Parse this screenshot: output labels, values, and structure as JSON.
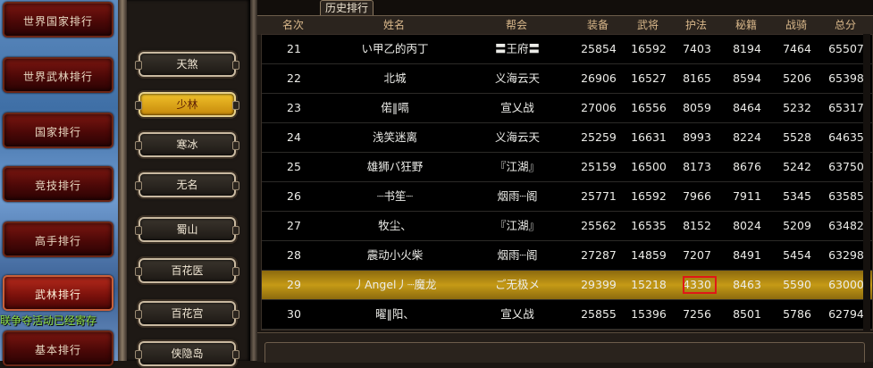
{
  "menu": {
    "items": [
      {
        "label": "世界国家排行",
        "active": false
      },
      {
        "label": "世界武林排行",
        "active": false
      },
      {
        "label": "国家排行",
        "active": false
      },
      {
        "label": "竞技排行",
        "active": false
      },
      {
        "label": "高手排行",
        "active": false
      },
      {
        "label": "武林排行",
        "active": true
      },
      {
        "label": "基本排行",
        "active": false
      }
    ],
    "notice": "联争夺活动已经寄存"
  },
  "schools": {
    "items": [
      {
        "label": "天煞",
        "active": false
      },
      {
        "label": "少林",
        "active": true
      },
      {
        "label": "寒冰",
        "active": false
      },
      {
        "label": "无名",
        "active": false
      },
      {
        "label": "蜀山",
        "active": false
      },
      {
        "label": "百花医",
        "active": false
      },
      {
        "label": "百花宫",
        "active": false
      },
      {
        "label": "侠隐岛",
        "active": false
      }
    ]
  },
  "ranking": {
    "tab_label": "历史排行",
    "columns": [
      "名次",
      "姓名",
      "帮会",
      "装备",
      "武将",
      "护法",
      "秘籍",
      "战骑",
      "总分"
    ],
    "rows": [
      [
        "21",
        "い甲乙的丙丁",
        "〓王府〓",
        "25854",
        "16592",
        "7403",
        "8194",
        "7464",
        "65507"
      ],
      [
        "22",
        "北城",
        "义海云天",
        "26906",
        "16527",
        "8165",
        "8594",
        "5206",
        "65398"
      ],
      [
        "23",
        "偌‖嗝",
        "宣乂战",
        "27006",
        "16556",
        "8059",
        "8464",
        "5232",
        "65317"
      ],
      [
        "24",
        "浅笑迷离",
        "义海云天",
        "25259",
        "16631",
        "8993",
        "8224",
        "5528",
        "64635"
      ],
      [
        "25",
        "雄狮バ狂野",
        "『江湖』",
        "25159",
        "16500",
        "8173",
        "8676",
        "5242",
        "63750"
      ],
      [
        "26",
        "┈书笙┈",
        "烟雨┈阁",
        "25771",
        "16592",
        "7966",
        "7911",
        "5345",
        "63585"
      ],
      [
        "27",
        "牧尘、",
        "『江湖』",
        "25562",
        "16535",
        "8152",
        "8024",
        "5209",
        "63482"
      ],
      [
        "28",
        "震动小火柴",
        "烟雨┈阁",
        "27287",
        "14859",
        "7207",
        "8491",
        "5454",
        "63298"
      ],
      [
        "29",
        "丿Angel丿┈魔龙",
        "ご无极メ",
        "29399",
        "15218",
        "4330",
        "8463",
        "5590",
        "63000"
      ],
      [
        "30",
        "曜‖阳、",
        "宣乂战",
        "25855",
        "15396",
        "7256",
        "8501",
        "5786",
        "62794"
      ]
    ],
    "highlight_row": 8,
    "highlight_color": "#c59a16",
    "marker_color": "#e01818"
  }
}
